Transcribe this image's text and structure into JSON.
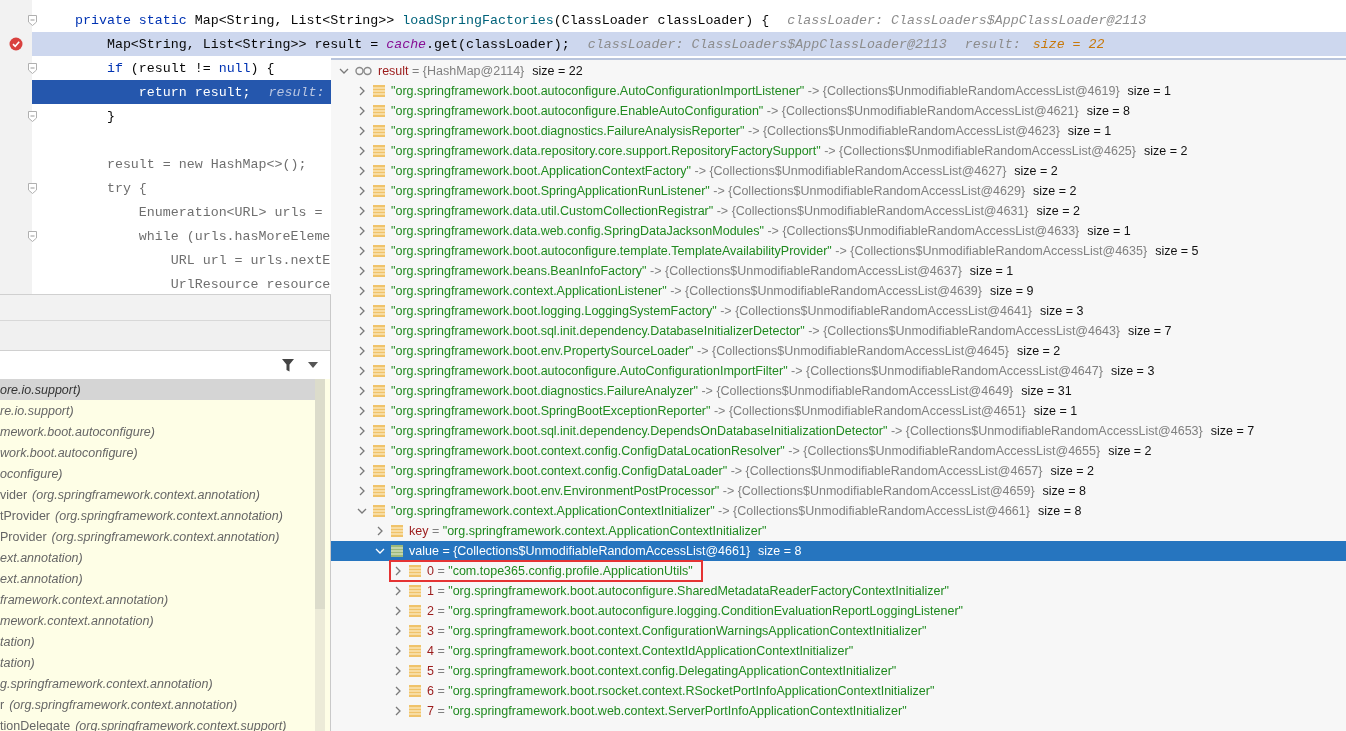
{
  "editor": {
    "lines": [
      {
        "fold": true,
        "current": false,
        "breakpoint": false,
        "parts": [
          {
            "kind": "kw",
            "text": "private static"
          },
          {
            "kind": "plain",
            "text": " Map<String, List<String>> "
          },
          {
            "kind": "method",
            "text": "loadSpringFactories"
          },
          {
            "kind": "plain",
            "text": "(ClassLoader classLoader) {"
          }
        ],
        "hints": [
          {
            "kind": "label",
            "text": "classLoader: ClassLoaders$AppClassLoader@2113"
          }
        ]
      },
      {
        "fold": false,
        "current": false,
        "breakpoint": true,
        "parts": [
          {
            "kind": "plain",
            "text": "    Map<String, List<String>> result = "
          },
          {
            "kind": "field",
            "text": "cache"
          },
          {
            "kind": "plain",
            "text": ".get(classLoader);"
          }
        ],
        "hints": [
          {
            "kind": "label",
            "text": "classLoader: ClassLoaders$AppClassLoader@2113"
          },
          {
            "kind": "label",
            "text": "result:"
          },
          {
            "kind": "value",
            "text": "size = 22"
          }
        ]
      },
      {
        "fold": true,
        "current": false,
        "breakpoint": false,
        "parts": [
          {
            "kind": "kw",
            "text": "    if"
          },
          {
            "kind": "plain",
            "text": " (result != "
          },
          {
            "kind": "kw",
            "text": "null"
          },
          {
            "kind": "plain",
            "text": ") {"
          }
        ]
      },
      {
        "fold": false,
        "current": true,
        "breakpoint": false,
        "parts": [
          {
            "kind": "plain",
            "text": "        return result;"
          }
        ],
        "hints": [
          {
            "kind": "label",
            "text": "result:"
          }
        ]
      },
      {
        "fold": true,
        "current": false,
        "breakpoint": false,
        "parts": [
          {
            "kind": "plain",
            "text": "    }"
          }
        ]
      },
      {
        "fold": false,
        "current": false,
        "breakpoint": false
      },
      {
        "fold": false,
        "current": false,
        "breakpoint": false,
        "parts": [
          {
            "kind": "dim",
            "text": "    result = new HashMap<>();"
          }
        ]
      },
      {
        "fold": true,
        "current": false,
        "breakpoint": false,
        "parts": [
          {
            "kind": "dim",
            "text": "    try {"
          }
        ]
      },
      {
        "fold": false,
        "current": false,
        "breakpoint": false,
        "parts": [
          {
            "kind": "dim",
            "text": "        Enumeration<URL> urls ="
          }
        ]
      },
      {
        "fold": true,
        "current": false,
        "breakpoint": false,
        "parts": [
          {
            "kind": "dim",
            "text": "        while (urls.hasMoreEleme"
          }
        ]
      },
      {
        "fold": false,
        "current": false,
        "breakpoint": false,
        "parts": [
          {
            "kind": "dim",
            "text": "            URL url = urls.nextE"
          }
        ]
      },
      {
        "fold": false,
        "current": false,
        "breakpoint": false,
        "parts": [
          {
            "kind": "dim",
            "text": "            UrlResource resource"
          }
        ]
      }
    ]
  },
  "frames": [
    {
      "package": "ore.io.support)",
      "selected": true
    },
    {
      "package": "re.io.support)",
      "selected": false
    },
    {
      "package": "mework.boot.autoconfigure)",
      "selected": false
    },
    {
      "package": "work.boot.autoconfigure)",
      "selected": false
    },
    {
      "package": "oconfigure)",
      "selected": false
    },
    {
      "method": "vider",
      "package": "(org.springframework.context.annotation)",
      "selected": false
    },
    {
      "method": "tProvider",
      "package": "(org.springframework.context.annotation)",
      "selected": false
    },
    {
      "method": "Provider",
      "package": "(org.springframework.context.annotation)",
      "selected": false
    },
    {
      "package": "ext.annotation)",
      "selected": false
    },
    {
      "package": "ext.annotation)",
      "selected": false
    },
    {
      "package": "framework.context.annotation)",
      "selected": false
    },
    {
      "package": "mework.context.annotation)",
      "selected": false
    },
    {
      "package": "tation)",
      "selected": false
    },
    {
      "package": "tation)",
      "selected": false
    },
    {
      "package": "g.springframework.context.annotation)",
      "selected": false
    },
    {
      "method": "r",
      "package": "(org.springframework.context.annotation)",
      "selected": false
    },
    {
      "method": "tionDelegate",
      "package": "(org.springframework.context.support)",
      "selected": false
    }
  ],
  "variables": [
    {
      "kind": "root",
      "name": "result",
      "sep": "=",
      "value": "{HashMap@2114}",
      "string_value": false,
      "size": "size = 22",
      "expanded": true,
      "selected": false,
      "outlined": false,
      "children": [
        {
          "kind": "entry",
          "name": "\"org.springframework.boot.autoconfigure.AutoConfigurationImportListener\"",
          "sep": "->",
          "value": "{Collections$UnmodifiableRandomAccessList@4619}",
          "string_value": false,
          "size": "size = 1",
          "expanded": false,
          "selected": false,
          "outlined": false
        },
        {
          "kind": "entry",
          "name": "\"org.springframework.boot.autoconfigure.EnableAutoConfiguration\"",
          "sep": "->",
          "value": "{Collections$UnmodifiableRandomAccessList@4621}",
          "string_value": false,
          "size": "size = 8",
          "expanded": false,
          "selected": false,
          "outlined": false
        },
        {
          "kind": "entry",
          "name": "\"org.springframework.boot.diagnostics.FailureAnalysisReporter\"",
          "sep": "->",
          "value": "{Collections$UnmodifiableRandomAccessList@4623}",
          "string_value": false,
          "size": "size = 1",
          "expanded": false,
          "selected": false,
          "outlined": false
        },
        {
          "kind": "entry",
          "name": "\"org.springframework.data.repository.core.support.RepositoryFactorySupport\"",
          "sep": "->",
          "value": "{Collections$UnmodifiableRandomAccessList@4625}",
          "string_value": false,
          "size": "size = 2",
          "expanded": false,
          "selected": false,
          "outlined": false
        },
        {
          "kind": "entry",
          "name": "\"org.springframework.boot.ApplicationContextFactory\"",
          "sep": "->",
          "value": "{Collections$UnmodifiableRandomAccessList@4627}",
          "string_value": false,
          "size": "size = 2",
          "expanded": false,
          "selected": false,
          "outlined": false
        },
        {
          "kind": "entry",
          "name": "\"org.springframework.boot.SpringApplicationRunListener\"",
          "sep": "->",
          "value": "{Collections$UnmodifiableRandomAccessList@4629}",
          "string_value": false,
          "size": "size = 2",
          "expanded": false,
          "selected": false,
          "outlined": false
        },
        {
          "kind": "entry",
          "name": "\"org.springframework.data.util.CustomCollectionRegistrar\"",
          "sep": "->",
          "value": "{Collections$UnmodifiableRandomAccessList@4631}",
          "string_value": false,
          "size": "size = 2",
          "expanded": false,
          "selected": false,
          "outlined": false
        },
        {
          "kind": "entry",
          "name": "\"org.springframework.data.web.config.SpringDataJacksonModules\"",
          "sep": "->",
          "value": "{Collections$UnmodifiableRandomAccessList@4633}",
          "string_value": false,
          "size": "size = 1",
          "expanded": false,
          "selected": false,
          "outlined": false
        },
        {
          "kind": "entry",
          "name": "\"org.springframework.boot.autoconfigure.template.TemplateAvailabilityProvider\"",
          "sep": "->",
          "value": "{Collections$UnmodifiableRandomAccessList@4635}",
          "string_value": false,
          "size": "size = 5",
          "expanded": false,
          "selected": false,
          "outlined": false
        },
        {
          "kind": "entry",
          "name": "\"org.springframework.beans.BeanInfoFactory\"",
          "sep": "->",
          "value": "{Collections$UnmodifiableRandomAccessList@4637}",
          "string_value": false,
          "size": "size = 1",
          "expanded": false,
          "selected": false,
          "outlined": false
        },
        {
          "kind": "entry",
          "name": "\"org.springframework.context.ApplicationListener\"",
          "sep": "->",
          "value": "{Collections$UnmodifiableRandomAccessList@4639}",
          "string_value": false,
          "size": "size = 9",
          "expanded": false,
          "selected": false,
          "outlined": false
        },
        {
          "kind": "entry",
          "name": "\"org.springframework.boot.logging.LoggingSystemFactory\"",
          "sep": "->",
          "value": "{Collections$UnmodifiableRandomAccessList@4641}",
          "string_value": false,
          "size": "size = 3",
          "expanded": false,
          "selected": false,
          "outlined": false
        },
        {
          "kind": "entry",
          "name": "\"org.springframework.boot.sql.init.dependency.DatabaseInitializerDetector\"",
          "sep": "->",
          "value": "{Collections$UnmodifiableRandomAccessList@4643}",
          "string_value": false,
          "size": "size = 7",
          "expanded": false,
          "selected": false,
          "outlined": false
        },
        {
          "kind": "entry",
          "name": "\"org.springframework.boot.env.PropertySourceLoader\"",
          "sep": "->",
          "value": "{Collections$UnmodifiableRandomAccessList@4645}",
          "string_value": false,
          "size": "size = 2",
          "expanded": false,
          "selected": false,
          "outlined": false
        },
        {
          "kind": "entry",
          "name": "\"org.springframework.boot.autoconfigure.AutoConfigurationImportFilter\"",
          "sep": "->",
          "value": "{Collections$UnmodifiableRandomAccessList@4647}",
          "string_value": false,
          "size": "size = 3",
          "expanded": false,
          "selected": false,
          "outlined": false
        },
        {
          "kind": "entry",
          "name": "\"org.springframework.boot.diagnostics.FailureAnalyzer\"",
          "sep": "->",
          "value": "{Collections$UnmodifiableRandomAccessList@4649}",
          "string_value": false,
          "size": "size = 31",
          "expanded": false,
          "selected": false,
          "outlined": false
        },
        {
          "kind": "entry",
          "name": "\"org.springframework.boot.SpringBootExceptionReporter\"",
          "sep": "->",
          "value": "{Collections$UnmodifiableRandomAccessList@4651}",
          "string_value": false,
          "size": "size = 1",
          "expanded": false,
          "selected": false,
          "outlined": false
        },
        {
          "kind": "entry",
          "name": "\"org.springframework.boot.sql.init.dependency.DependsOnDatabaseInitializationDetector\"",
          "sep": "->",
          "value": "{Collections$UnmodifiableRandomAccessList@4653}",
          "string_value": false,
          "size": "size = 7",
          "expanded": false,
          "selected": false,
          "outlined": false
        },
        {
          "kind": "entry",
          "name": "\"org.springframework.boot.context.config.ConfigDataLocationResolver\"",
          "sep": "->",
          "value": "{Collections$UnmodifiableRandomAccessList@4655}",
          "string_value": false,
          "size": "size = 2",
          "expanded": false,
          "selected": false,
          "outlined": false
        },
        {
          "kind": "entry",
          "name": "\"org.springframework.boot.context.config.ConfigDataLoader\"",
          "sep": "->",
          "value": "{Collections$UnmodifiableRandomAccessList@4657}",
          "string_value": false,
          "size": "size = 2",
          "expanded": false,
          "selected": false,
          "outlined": false
        },
        {
          "kind": "entry",
          "name": "\"org.springframework.boot.env.EnvironmentPostProcessor\"",
          "sep": "->",
          "value": "{Collections$UnmodifiableRandomAccessList@4659}",
          "string_value": false,
          "size": "size = 8",
          "expanded": false,
          "selected": false,
          "outlined": false
        },
        {
          "kind": "entry",
          "name": "\"org.springframework.context.ApplicationContextInitializer\"",
          "sep": "->",
          "value": "{Collections$UnmodifiableRandomAccessList@4661}",
          "string_value": false,
          "size": "size = 8",
          "expanded": true,
          "selected": false,
          "outlined": false,
          "children": [
            {
              "kind": "field",
              "name": "key",
              "sep": "=",
              "value": "\"org.springframework.context.ApplicationContextInitializer\"",
              "string_value": true,
              "expanded": false,
              "selected": false,
              "outlined": false
            },
            {
              "kind": "field",
              "name": "value",
              "sep": "=",
              "value": "{Collections$UnmodifiableRandomAccessList@4661}",
              "string_value": false,
              "size": "size = 8",
              "expanded": true,
              "selected": true,
              "outlined": false,
              "children": [
                {
                  "kind": "field",
                  "name": "0",
                  "sep": "=",
                  "value": "\"com.tope365.config.profile.ApplicationUtils\"",
                  "string_value": true,
                  "expanded": false,
                  "selected": false,
                  "outlined": true
                },
                {
                  "kind": "field",
                  "name": "1",
                  "sep": "=",
                  "value": "\"org.springframework.boot.autoconfigure.SharedMetadataReaderFactoryContextInitializer\"",
                  "string_value": true,
                  "expanded": false,
                  "selected": false,
                  "outlined": false
                },
                {
                  "kind": "field",
                  "name": "2",
                  "sep": "=",
                  "value": "\"org.springframework.boot.autoconfigure.logging.ConditionEvaluationReportLoggingListener\"",
                  "string_value": true,
                  "expanded": false,
                  "selected": false,
                  "outlined": false
                },
                {
                  "kind": "field",
                  "name": "3",
                  "sep": "=",
                  "value": "\"org.springframework.boot.context.ConfigurationWarningsApplicationContextInitializer\"",
                  "string_value": true,
                  "expanded": false,
                  "selected": false,
                  "outlined": false
                },
                {
                  "kind": "field",
                  "name": "4",
                  "sep": "=",
                  "value": "\"org.springframework.boot.context.ContextIdApplicationContextInitializer\"",
                  "string_value": true,
                  "expanded": false,
                  "selected": false,
                  "outlined": false
                },
                {
                  "kind": "field",
                  "name": "5",
                  "sep": "=",
                  "value": "\"org.springframework.boot.context.config.DelegatingApplicationContextInitializer\"",
                  "string_value": true,
                  "expanded": false,
                  "selected": false,
                  "outlined": false
                },
                {
                  "kind": "field",
                  "name": "6",
                  "sep": "=",
                  "value": "\"org.springframework.boot.rsocket.context.RSocketPortInfoApplicationContextInitializer\"",
                  "string_value": true,
                  "expanded": false,
                  "selected": false,
                  "outlined": false
                },
                {
                  "kind": "field",
                  "name": "7",
                  "sep": "=",
                  "value": "\"org.springframework.boot.web.context.ServerPortInfoApplicationContextInitializer\"",
                  "string_value": true,
                  "expanded": false,
                  "selected": false,
                  "outlined": false
                }
              ]
            }
          ]
        }
      ]
    }
  ]
}
